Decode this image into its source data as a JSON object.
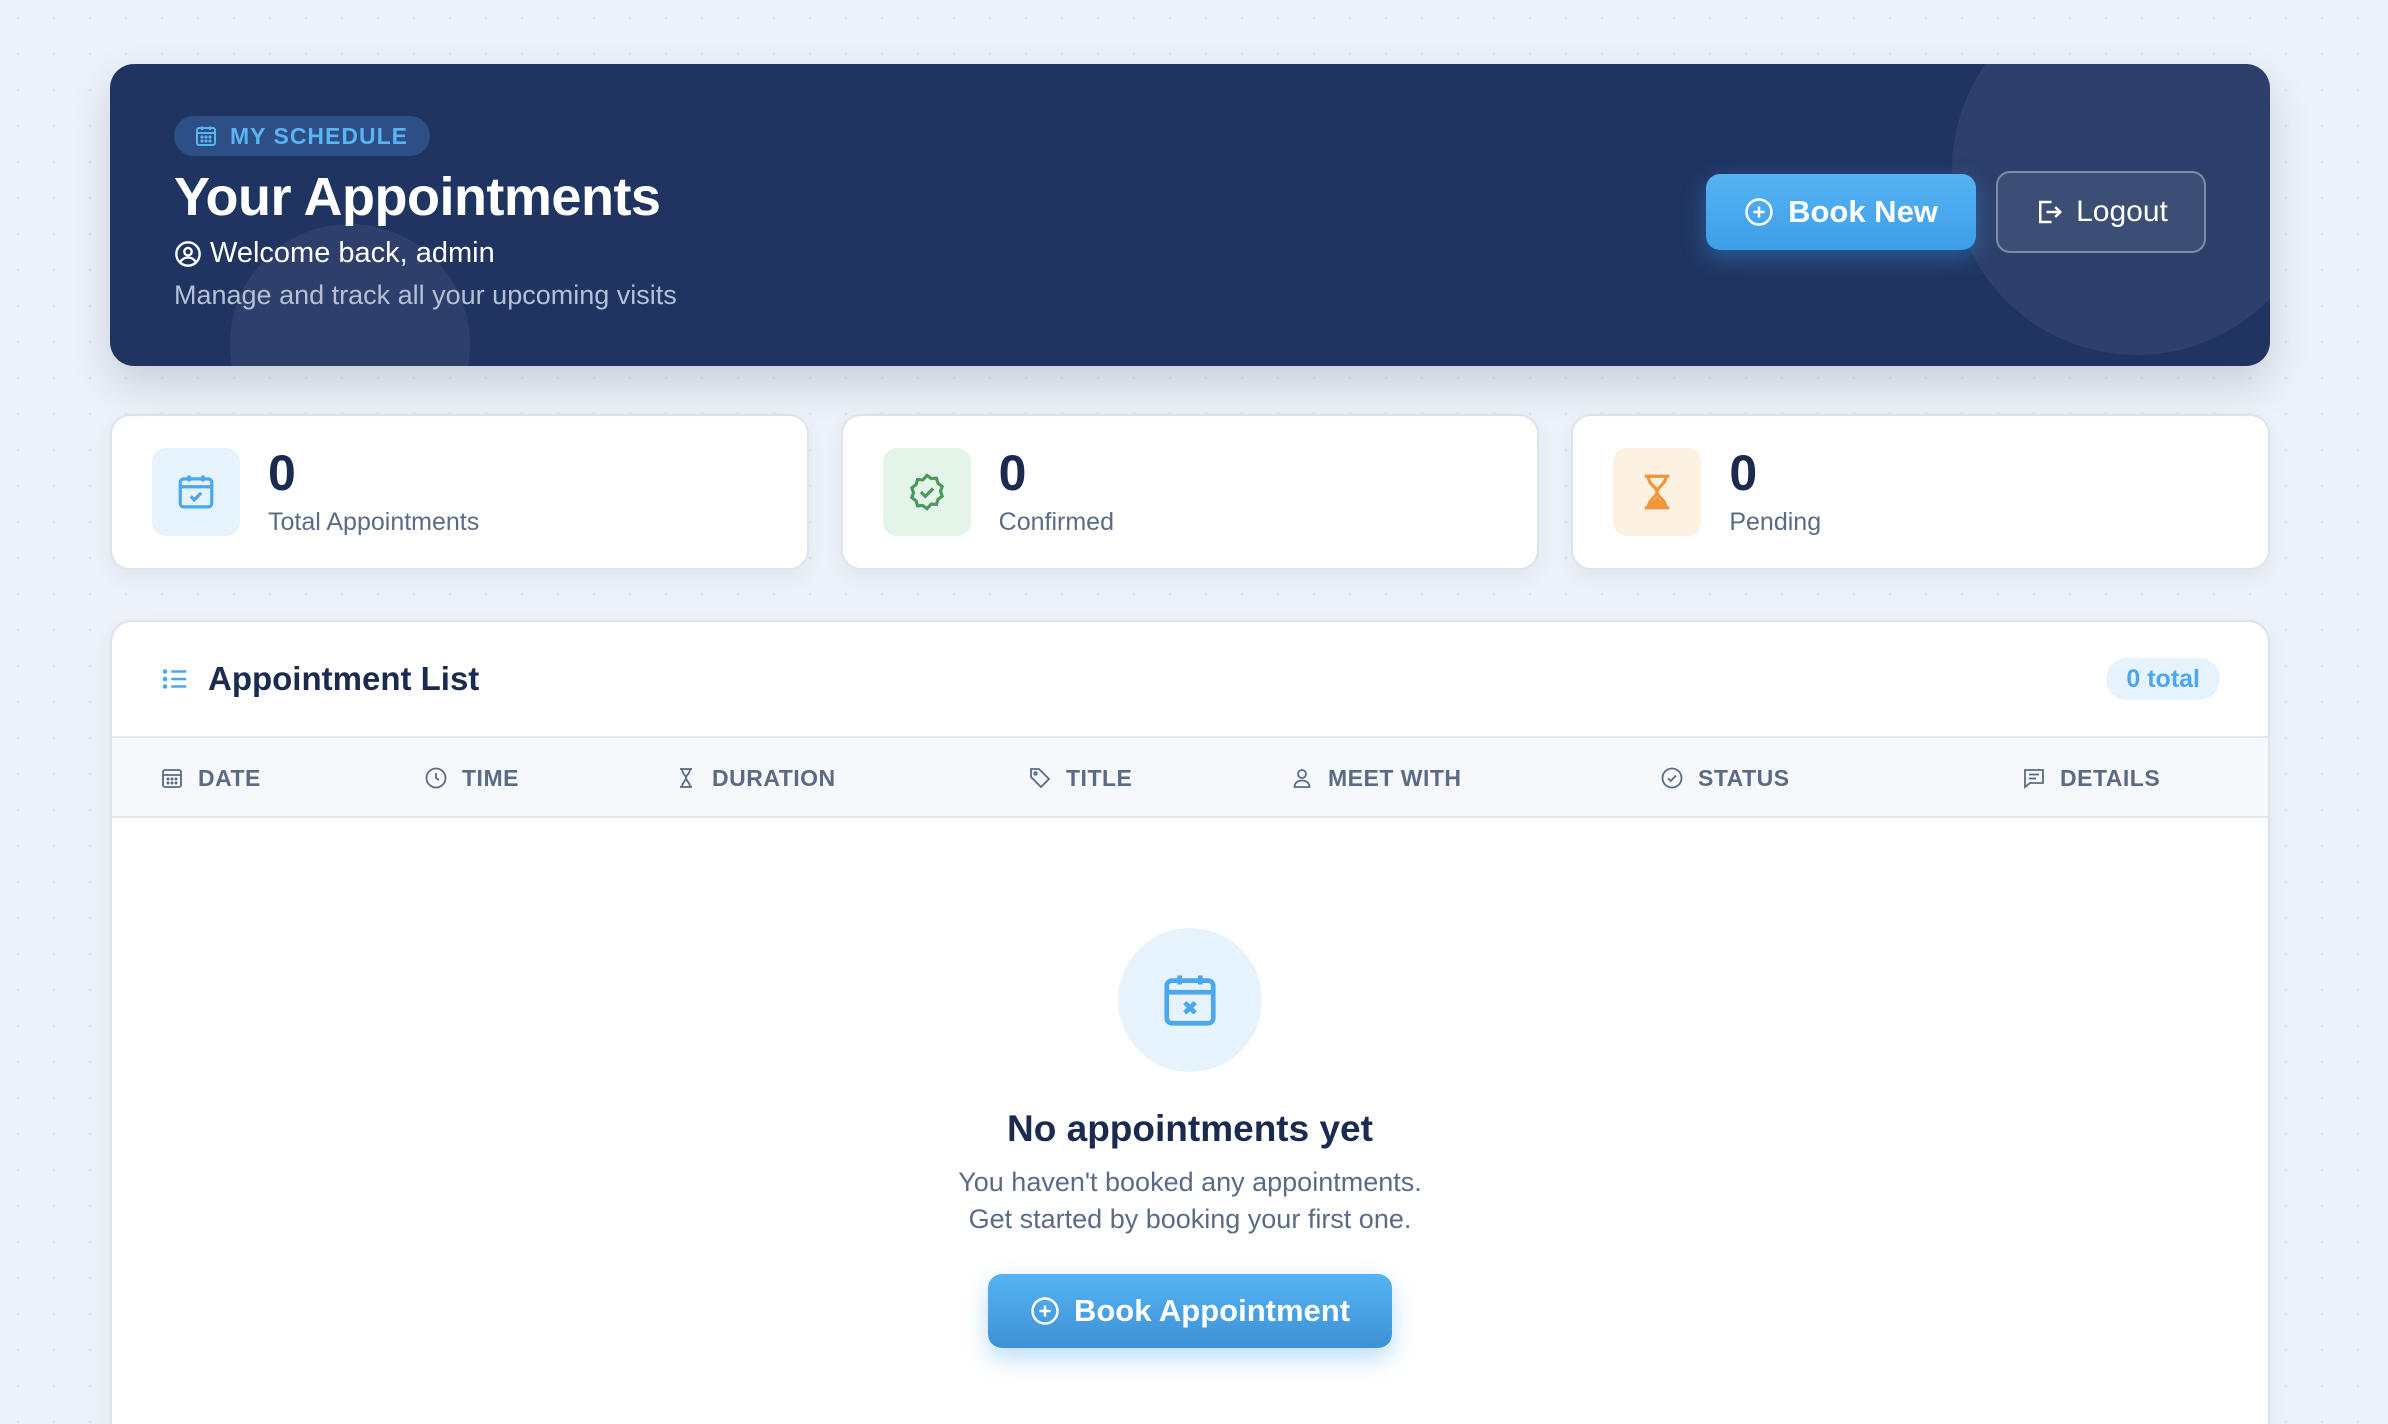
{
  "hero": {
    "badge": "MY SCHEDULE",
    "title": "Your Appointments",
    "welcome": "Welcome back, admin",
    "subtitle": "Manage and track all your upcoming visits",
    "book_label": "Book New",
    "logout_label": "Logout"
  },
  "stats": [
    {
      "value": "0",
      "label": "Total Appointments",
      "icon": "calendar-check-icon"
    },
    {
      "value": "0",
      "label": "Confirmed",
      "icon": "badge-check-icon"
    },
    {
      "value": "0",
      "label": "Pending",
      "icon": "hourglass-icon"
    }
  ],
  "list": {
    "title": "Appointment List",
    "total": "0 total",
    "columns": [
      "DATE",
      "TIME",
      "DURATION",
      "TITLE",
      "MEET WITH",
      "STATUS",
      "DETAILS"
    ]
  },
  "empty": {
    "title": "No appointments yet",
    "line1": "You haven't booked any appointments.",
    "line2": "Get started by booking your first one.",
    "button": "Book Appointment"
  },
  "colors": {
    "hero_bg": "#203461",
    "accent": "#4aa7ee",
    "text_dark": "#1b2b4f",
    "text_muted": "#5b6b86"
  }
}
